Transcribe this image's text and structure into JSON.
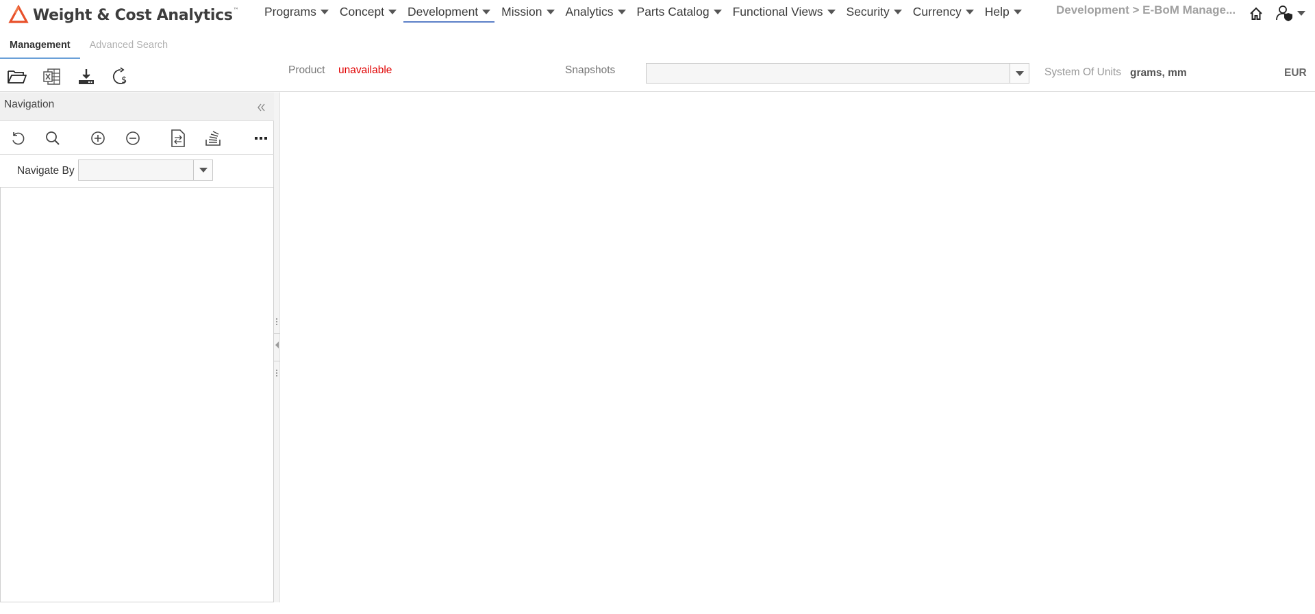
{
  "app": {
    "title": "Weight & Cost Analytics",
    "trademark": "™",
    "brand_color": "#e8502a"
  },
  "menu": {
    "items": [
      {
        "label": "Programs"
      },
      {
        "label": "Concept"
      },
      {
        "label": "Development",
        "active": true
      },
      {
        "label": "Mission"
      },
      {
        "label": "Analytics"
      },
      {
        "label": "Parts Catalog"
      },
      {
        "label": "Functional Views"
      },
      {
        "label": "Security"
      },
      {
        "label": "Currency"
      },
      {
        "label": "Help"
      }
    ],
    "active_underline_color": "#5b7fc7"
  },
  "breadcrumb": "Development > E-BoM Manage...",
  "header_icons": [
    "home-icon",
    "user-shield-icon",
    "chevron-down-icon"
  ],
  "subtabs": [
    {
      "label": "Management",
      "active": true
    },
    {
      "label": "Advanced Search",
      "active": false
    }
  ],
  "toolbar": {
    "icons": [
      "folder-open-icon",
      "excel-export-icon",
      "download-icon",
      "refresh-cost-icon"
    ],
    "product_label": "Product",
    "product_value": "unavailable",
    "product_value_color": "#e00000",
    "snapshots_label": "Snapshots",
    "snapshots_value": "",
    "units_label": "System Of Units",
    "units_value": "grams, mm",
    "currency": "EUR"
  },
  "navigation": {
    "title": "Navigation",
    "tools": [
      "refresh-icon",
      "search-icon",
      "expand-icon",
      "collapse-icon",
      "compare-icon",
      "stack-icon",
      "more-icon"
    ],
    "navigate_by_label": "Navigate By",
    "navigate_by_value": ""
  }
}
